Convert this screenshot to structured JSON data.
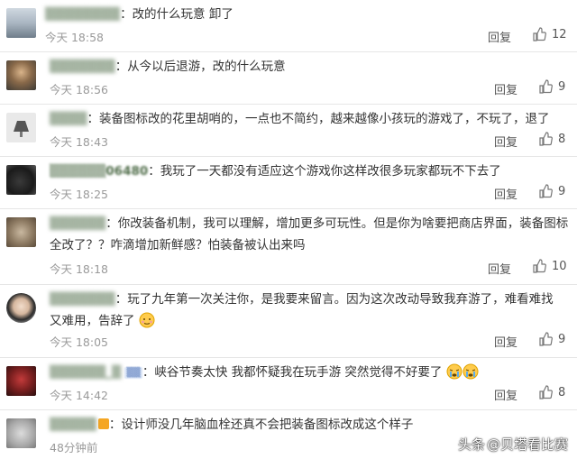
{
  "comments": [
    {
      "username": "▒▒▒▒▒▒▒▒",
      "text": "改的什么玩意  卸了",
      "time": "今天 18:58",
      "reply": "回复",
      "likes": "12"
    },
    {
      "username": "▒▒▒▒▒▒▒",
      "text": "从今以后退游，改的什么玩意",
      "time": "今天 18:56",
      "reply": "回复",
      "likes": "9"
    },
    {
      "username": "▒▒▒▒",
      "text": "装备图标改的花里胡哨的，一点也不简约，越来越像小孩玩的游戏了，不玩了，退了",
      "time": "今天 18:43",
      "reply": "回复",
      "likes": "8"
    },
    {
      "username": "▒▒▒▒▒▒06480",
      "text": "我玩了一天都没有适应这个游戏你这样改很多玩家都玩不下去了",
      "time": "今天 18:25",
      "reply": "回复",
      "likes": "9"
    },
    {
      "username": "▒▒▒▒▒▒",
      "text": "你改装备机制，我可以理解，增加更多可玩性。但是你为啥要把商店界面，装备图标",
      "text2": "全改了？？咋滴增加新鲜感？怕装备被认出来吗",
      "time": "今天 18:18",
      "reply": "回复",
      "likes": "10"
    },
    {
      "username": "▒▒▒▒▒▒▒",
      "text": "玩了九年第一次关注你，是我要来留言。因为这次改动导致我弃游了，难看难找",
      "text2": "又难用，告辞了",
      "time": "今天 18:05",
      "reply": "回复",
      "likes": "9"
    },
    {
      "username": "▒▒▒▒▒▒_▒",
      "badge": "▒▒",
      "text": "峡谷节奏太快  我都怀疑我在玩手游  突然觉得不好要了",
      "time": "今天 14:42",
      "reply": "回复",
      "likes": "8"
    },
    {
      "username": "▒▒▒▒▒",
      "text": "设计师没几年脑血栓还真不会把装备图标改成这个样子",
      "time": "48分钟前",
      "reply": "",
      "likes": ""
    }
  ],
  "watermark": {
    "prefix": "头条",
    "text": "@贝塔看比赛"
  },
  "icons": {
    "like": "thumbs-up-icon",
    "emoji_shy": "shy-face-emoji",
    "emoji_cry": "crying-face-emoji"
  },
  "colors": {
    "username": "#506d4a",
    "time": "#9a9a9a",
    "divider": "#e6e6e6"
  }
}
